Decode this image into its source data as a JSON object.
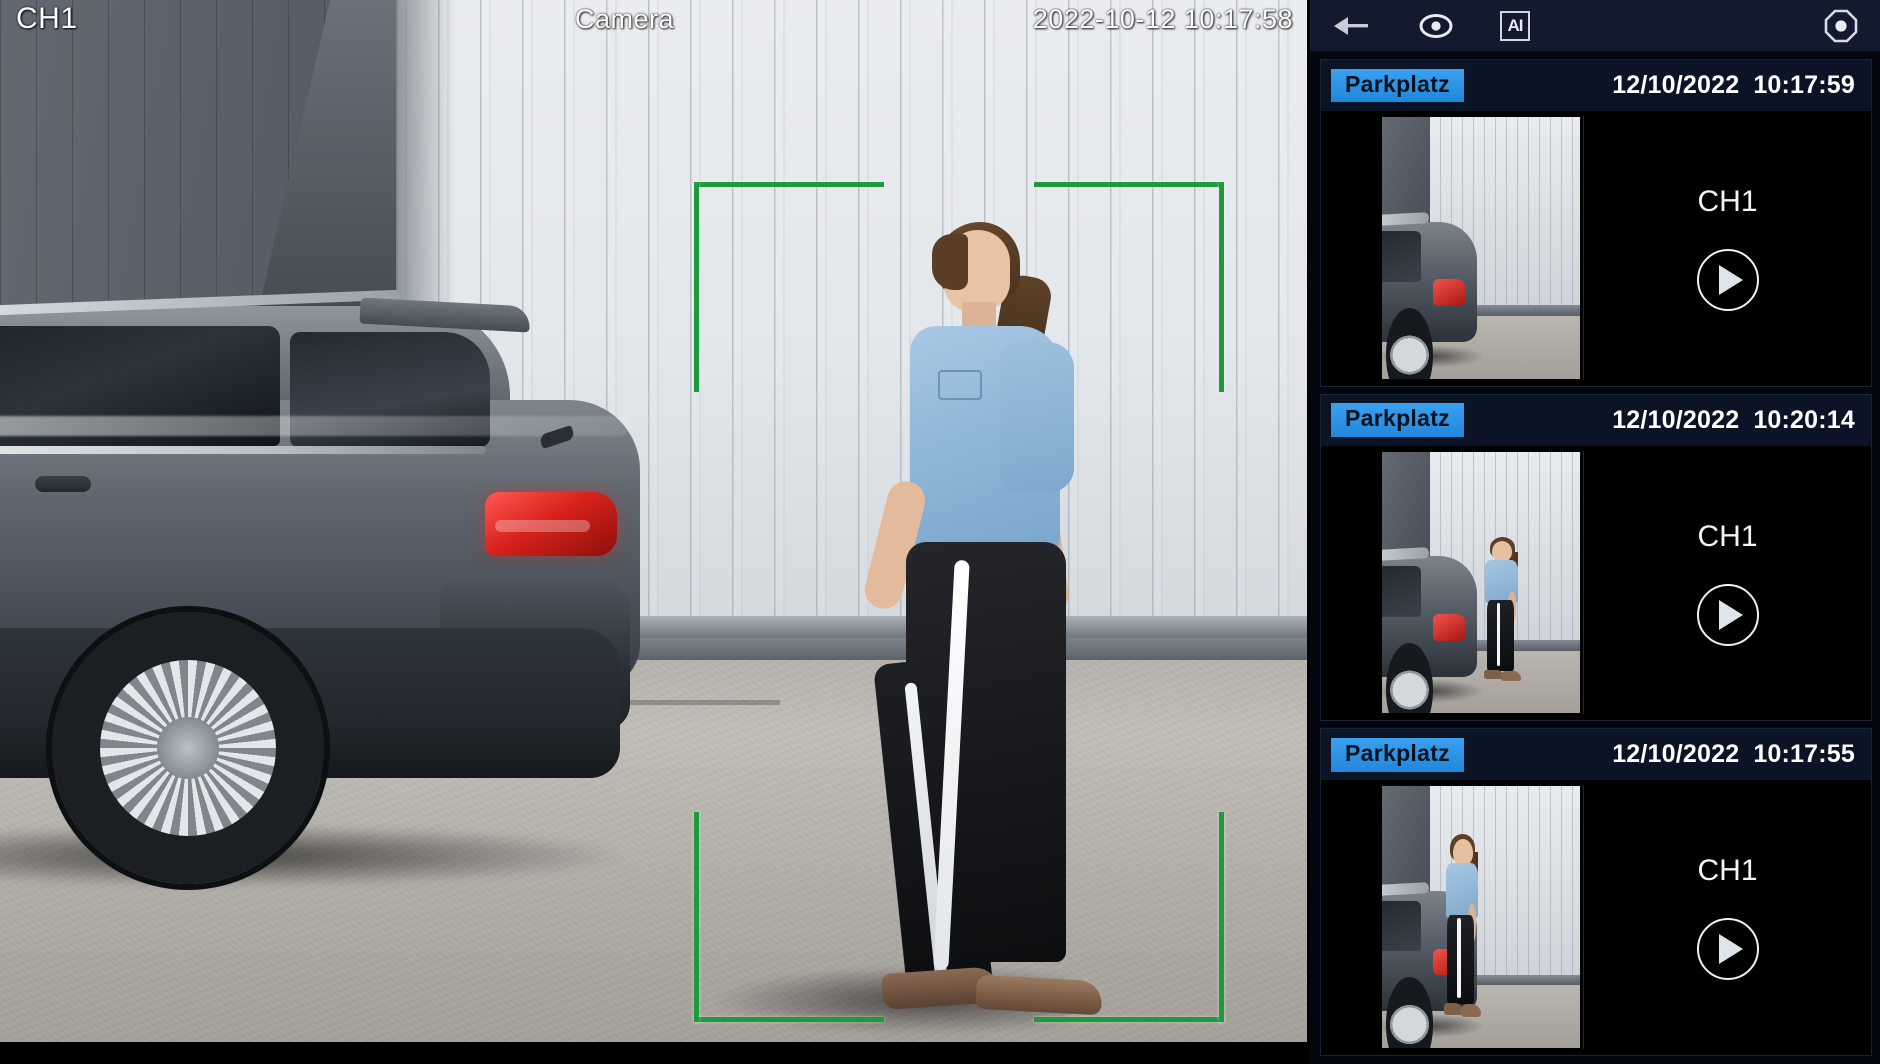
{
  "video": {
    "channel_label": "CH1",
    "camera_name": "Camera",
    "timestamp": "2022-10-12  10:17:58",
    "detection_box": "green-ai-detection-bracket"
  },
  "toolbar": {
    "back_icon": "back-arrow-icon",
    "target_icon": "eye-target-icon",
    "ai_label": "AI",
    "settings_icon": "record-settings-icon"
  },
  "events": [
    {
      "zone": "Parkplatz",
      "date": "12/10/2022",
      "time": "10:17:59",
      "channel": "CH1",
      "play_icon": "play-icon",
      "scene": "car-rear-at-white-wall"
    },
    {
      "zone": "Parkplatz",
      "date": "12/10/2022",
      "time": "10:20:14",
      "channel": "CH1",
      "play_icon": "play-icon",
      "scene": "person-walking-behind-car"
    },
    {
      "zone": "Parkplatz",
      "date": "12/10/2022",
      "time": "10:17:55",
      "channel": "CH1",
      "play_icon": "play-icon",
      "scene": "person-walking-beside-car"
    }
  ],
  "colors": {
    "badge_blue": "#2f98e8",
    "panel_bg": "#0a1020",
    "toolbar_bg": "#111a2e",
    "detection_green": "#1d9b3c",
    "text_white": "#ffffff"
  }
}
